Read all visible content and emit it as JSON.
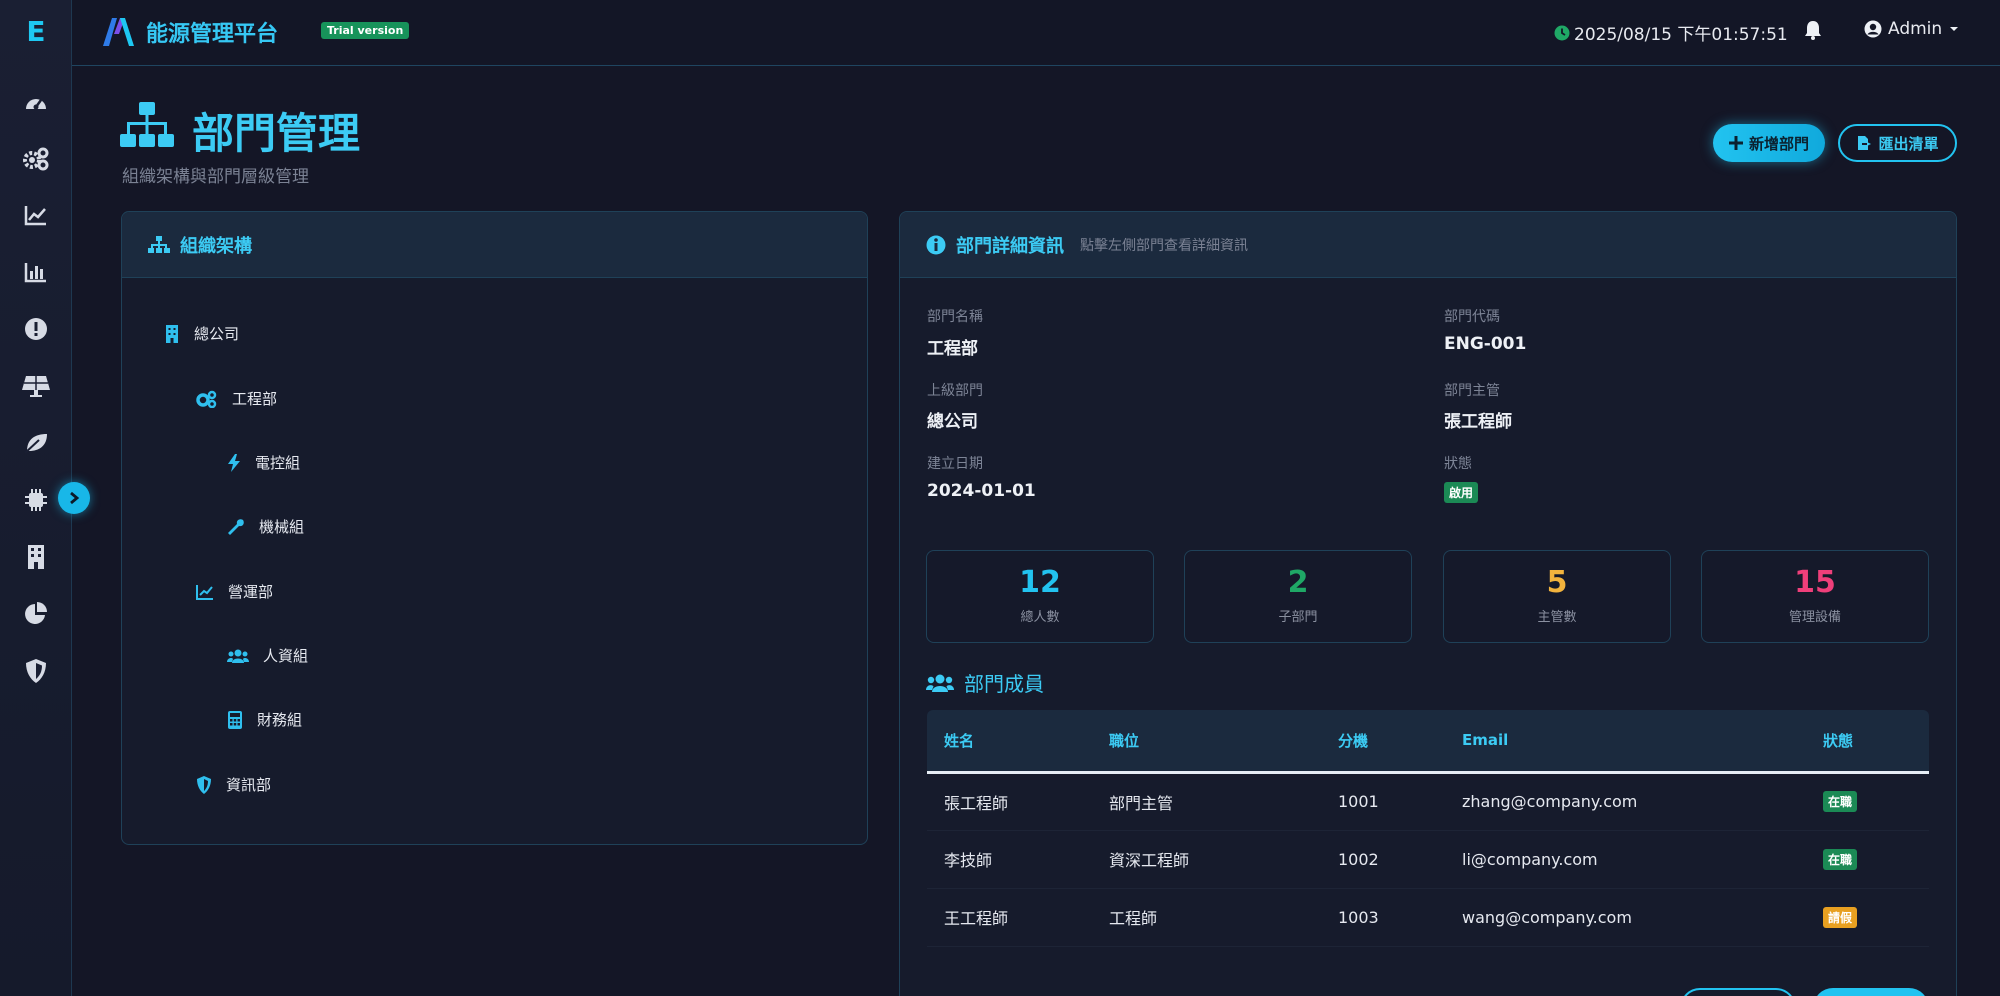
{
  "sidebar": {
    "logo": "E",
    "icons": [
      "dashboard-icon",
      "cogs-icon",
      "line-chart-icon",
      "bar-chart-icon",
      "alert-icon",
      "solar-panel-icon",
      "leaf-icon",
      "chip-icon",
      "building-icon",
      "pie-chart-icon",
      "shield-icon"
    ],
    "toggle_icon": "chevron-right-icon"
  },
  "header": {
    "app_title": "能源管理平台",
    "trial_badge": "Trial version",
    "datetime": "2025/08/15 下午01:57:51",
    "user": "Admin"
  },
  "page": {
    "title": "部門管理",
    "subtitle": "組織架構與部門層級管理",
    "add_button": "新增部門",
    "export_button": "匯出清單"
  },
  "tree_panel": {
    "title": "組織架構",
    "items": [
      {
        "label": "總公司",
        "icon": "building-icon"
      },
      {
        "label": "工程部",
        "icon": "cogs-icon"
      },
      {
        "label": "電控組",
        "icon": "bolt-icon"
      },
      {
        "label": "機械組",
        "icon": "wrench-icon"
      },
      {
        "label": "營運部",
        "icon": "line-chart-icon"
      },
      {
        "label": "人資組",
        "icon": "users-icon"
      },
      {
        "label": "財務組",
        "icon": "calculator-icon"
      },
      {
        "label": "資訊部",
        "icon": "shield-icon"
      }
    ]
  },
  "detail_panel": {
    "title": "部門詳細資訊",
    "hint": "點擊左側部門查看詳細資訊",
    "fields": {
      "name_label": "部門名稱",
      "name_value": "工程部",
      "code_label": "部門代碼",
      "code_value": "ENG-001",
      "parent_label": "上級部門",
      "parent_value": "總公司",
      "manager_label": "部門主管",
      "manager_value": "張工程師",
      "created_label": "建立日期",
      "created_value": "2024-01-01",
      "status_label": "狀態",
      "status_value": "啟用"
    },
    "stats": [
      {
        "value": "12",
        "label": "總人數",
        "color": "#22c3f0"
      },
      {
        "value": "2",
        "label": "子部門",
        "color": "#1fa866"
      },
      {
        "value": "5",
        "label": "主管數",
        "color": "#f2b33d"
      },
      {
        "value": "15",
        "label": "管理設備",
        "color": "#ef3f7a"
      }
    ],
    "members_title": "部門成員",
    "members_headers": [
      "姓名",
      "職位",
      "分機",
      "Email",
      "狀態"
    ],
    "members": [
      {
        "name": "張工程師",
        "position": "部門主管",
        "ext": "1001",
        "email": "zhang@company.com",
        "status": "在職",
        "status_color": "#1b8a55"
      },
      {
        "name": "李技師",
        "position": "資深工程師",
        "ext": "1002",
        "email": "li@company.com",
        "status": "在職",
        "status_color": "#1b8a55"
      },
      {
        "name": "王工程師",
        "position": "工程師",
        "ext": "1003",
        "email": "wang@company.com",
        "status": "請假",
        "status_color": "#e8a021"
      }
    ]
  }
}
